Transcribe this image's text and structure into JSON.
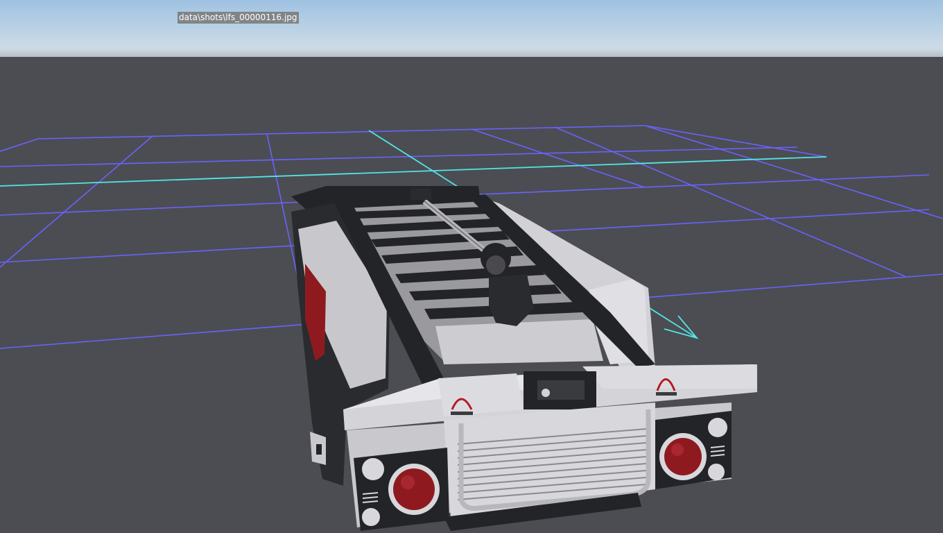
{
  "overlay": {
    "filename": "data\\shots\\lfs_00000116.jpg"
  },
  "scene": {
    "sky_color_top": "#9ec2e2",
    "sky_color_bottom": "#d5dce2",
    "ground_color": "#4b4d52",
    "grid_color": "#6a62ff",
    "axis_color": "#52e6e6",
    "vehicle_body_color": "#d9d9dd",
    "vehicle_frame_color": "#232427",
    "taillight_color": "#8e1a20"
  }
}
